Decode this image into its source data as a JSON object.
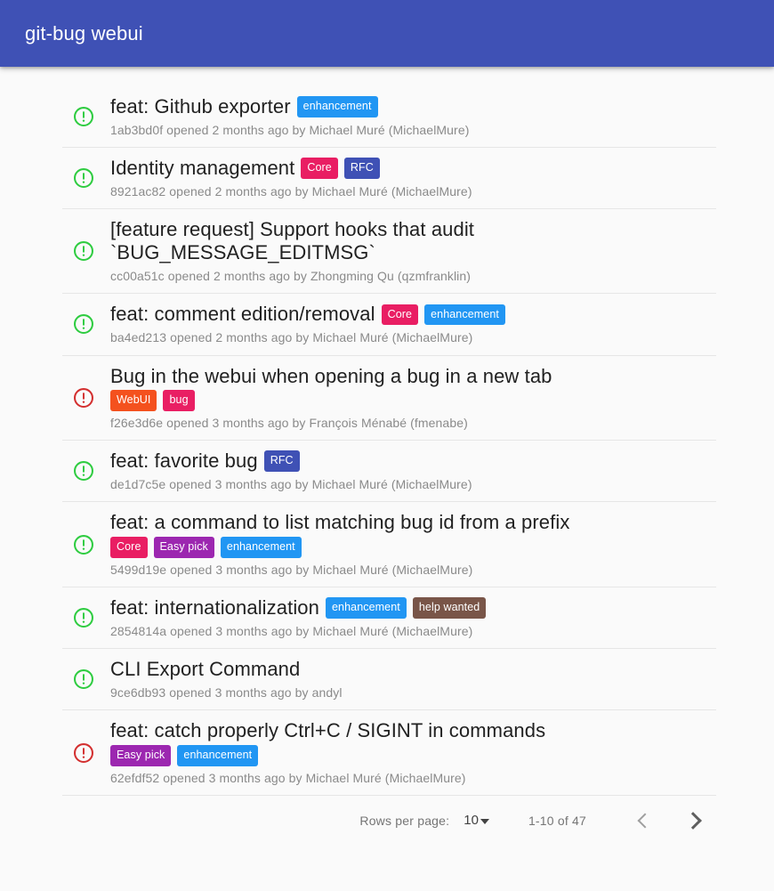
{
  "app": {
    "title": "git-bug webui",
    "bar_color": "#3f51b5",
    "background": "#fafafa"
  },
  "status_icons": {
    "open": {
      "name": "open-bug-icon",
      "color": "#2ecc40",
      "glyph": "exclamation-circle"
    },
    "closed": {
      "name": "closed-bug-icon",
      "color": "#d32f2f",
      "glyph": "exclamation-circle"
    }
  },
  "label_colors": {
    "enhancement": "#2196f3",
    "Core": "#e91e63",
    "RFC": "#3f51b5",
    "WebUI": "#f4511e",
    "bug": "#e91e63",
    "Easy pick": "#9c27b0",
    "help wanted": "#795548"
  },
  "bugs": [
    {
      "status": "open",
      "title": "feat: Github exporter",
      "labels": [
        "enhancement"
      ],
      "labels_on_own_line": false,
      "meta": "1ab3bd0f opened 2 months ago by Michael Muré (MichaelMure)",
      "id": "1ab3bd0f",
      "age": "2 months ago",
      "author": "Michael Muré (MichaelMure)"
    },
    {
      "status": "open",
      "title": "Identity management",
      "labels": [
        "Core",
        "RFC"
      ],
      "labels_on_own_line": false,
      "meta": "8921ac82 opened 2 months ago by Michael Muré (MichaelMure)",
      "id": "8921ac82",
      "age": "2 months ago",
      "author": "Michael Muré (MichaelMure)"
    },
    {
      "status": "open",
      "title": "[feature request] Support hooks that audit `BUG_MESSAGE_EDITMSG`",
      "labels": [],
      "labels_on_own_line": false,
      "meta": "cc00a51c opened 2 months ago by Zhongming Qu (qzmfranklin)",
      "id": "cc00a51c",
      "age": "2 months ago",
      "author": "Zhongming Qu (qzmfranklin)"
    },
    {
      "status": "open",
      "title": "feat: comment edition/removal",
      "labels": [
        "Core",
        "enhancement"
      ],
      "labels_on_own_line": false,
      "meta": "ba4ed213 opened 2 months ago by Michael Muré (MichaelMure)",
      "id": "ba4ed213",
      "age": "2 months ago",
      "author": "Michael Muré (MichaelMure)"
    },
    {
      "status": "closed",
      "title": "Bug in the webui when opening a bug in a new tab",
      "labels": [
        "WebUI",
        "bug"
      ],
      "labels_on_own_line": true,
      "meta": "f26e3d6e opened 3 months ago by François Ménabé (fmenabe)",
      "id": "f26e3d6e",
      "age": "3 months ago",
      "author": "François Ménabé (fmenabe)"
    },
    {
      "status": "open",
      "title": "feat: favorite bug",
      "labels": [
        "RFC"
      ],
      "labels_on_own_line": false,
      "meta": "de1d7c5e opened 3 months ago by Michael Muré (MichaelMure)",
      "id": "de1d7c5e",
      "age": "3 months ago",
      "author": "Michael Muré (MichaelMure)"
    },
    {
      "status": "open",
      "title": "feat: a command to list matching bug id from a prefix",
      "labels": [
        "Core",
        "Easy pick",
        "enhancement"
      ],
      "labels_on_own_line": true,
      "meta": "5499d19e opened 3 months ago by Michael Muré (MichaelMure)",
      "id": "5499d19e",
      "age": "3 months ago",
      "author": "Michael Muré (MichaelMure)"
    },
    {
      "status": "open",
      "title": "feat: internationalization",
      "labels": [
        "enhancement",
        "help wanted"
      ],
      "labels_on_own_line": false,
      "meta": "2854814a opened 3 months ago by Michael Muré (MichaelMure)",
      "id": "2854814a",
      "age": "3 months ago",
      "author": "Michael Muré (MichaelMure)"
    },
    {
      "status": "open",
      "title": "CLI Export Command",
      "labels": [],
      "labels_on_own_line": false,
      "meta": "9ce6db93 opened 3 months ago by andyl",
      "id": "9ce6db93",
      "age": "3 months ago",
      "author": "andyl"
    },
    {
      "status": "closed",
      "title": "feat: catch properly Ctrl+C / SIGINT in commands",
      "labels": [
        "Easy pick",
        "enhancement"
      ],
      "labels_on_own_line": true,
      "meta": "62efdf52 opened 3 months ago by Michael Muré (MichaelMure)",
      "id": "62efdf52",
      "age": "3 months ago",
      "author": "Michael Muré (MichaelMure)"
    }
  ],
  "pagination": {
    "rows_per_page_label": "Rows per page:",
    "rows_per_page_value": "10",
    "range_label": "1-10 of 47",
    "prev_icon": "chevron-left-icon",
    "next_icon": "chevron-right-icon"
  }
}
